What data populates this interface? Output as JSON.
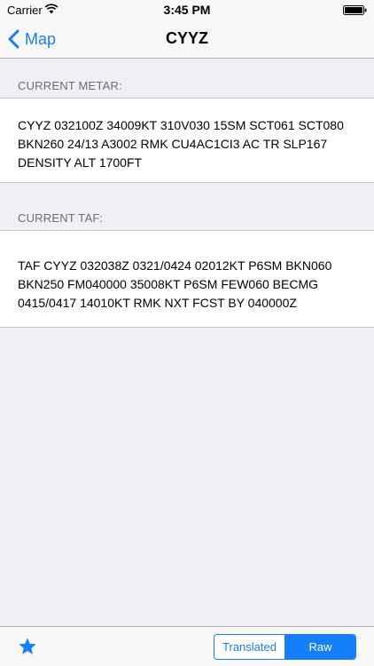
{
  "status_bar": {
    "carrier": "Carrier",
    "time": "3:45 PM"
  },
  "nav": {
    "back_label": "Map",
    "title": "CYYZ"
  },
  "metar": {
    "header": "CURRENT METAR:",
    "text": "CYYZ 032100Z 34009KT 310V030 15SM SCT061 SCT080 BKN260 24/13 A3002 RMK CU4AC1CI3 AC TR SLP167 DENSITY ALT 1700FT"
  },
  "taf": {
    "header": "CURRENT TAF:",
    "text": "TAF CYYZ 032038Z 0321/0424 02012KT P6SM BKN060 BKN250 FM040000 35008KT P6SM FEW060 BECMG 0415/0417 14010KT RMK NXT FCST BY 040000Z"
  },
  "toolbar": {
    "favorite_icon": "star-icon",
    "segments": [
      "Translated",
      "Raw"
    ],
    "selected_segment": "Raw"
  },
  "colors": {
    "accent": "#157efb",
    "background": "#efeff4",
    "bar": "#f7f7f7"
  }
}
